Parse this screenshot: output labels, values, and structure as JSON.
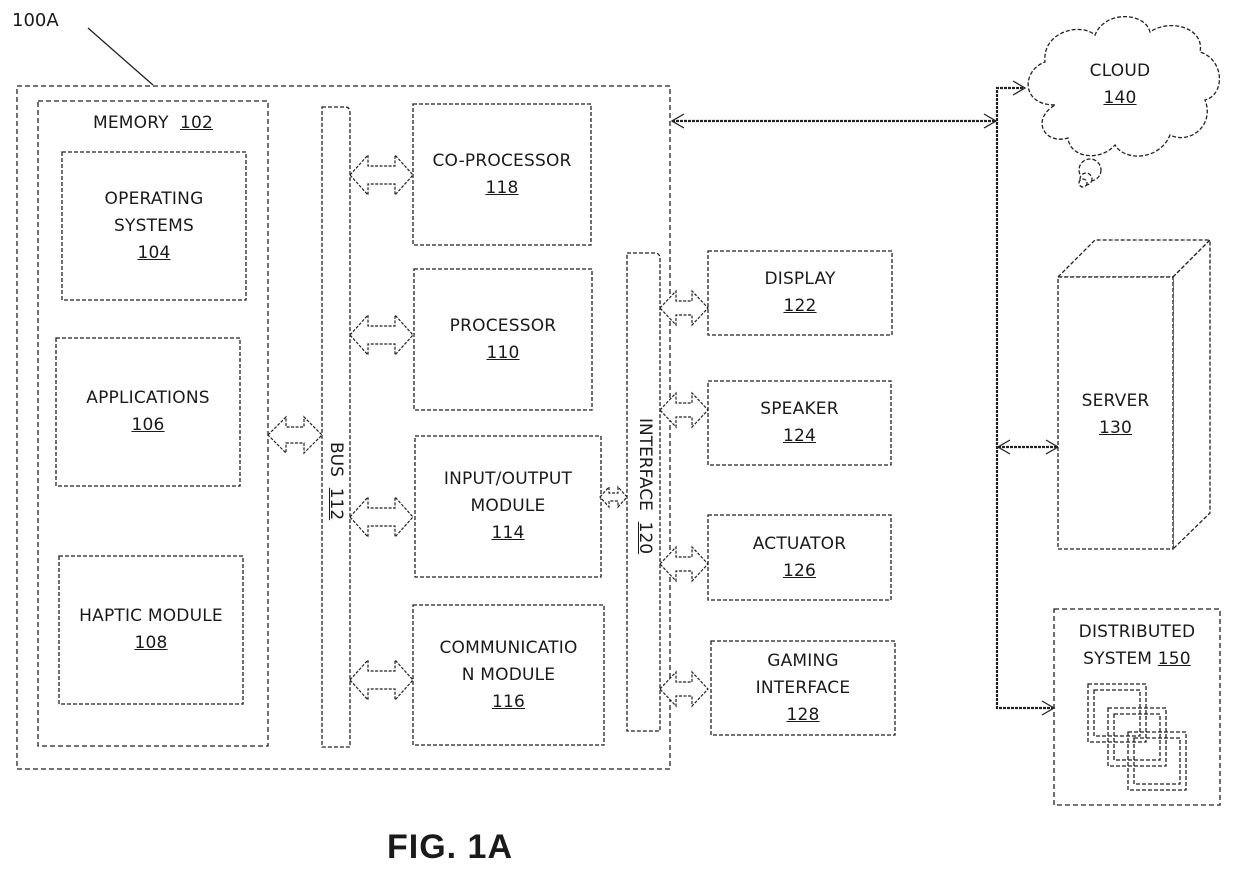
{
  "figure_label": "FIG. 1A",
  "system_ref": "100A",
  "memory": {
    "name": "MEMORY",
    "ref": "102"
  },
  "memory_items": [
    {
      "line1": "OPERATING",
      "line2": "SYSTEMS",
      "ref": "104"
    },
    {
      "line1": "APPLICATIONS",
      "line2": "",
      "ref": "106"
    },
    {
      "line1": "HAPTIC MODULE",
      "line2": "",
      "ref": "108"
    }
  ],
  "bus": {
    "name": "BUS",
    "ref": "112"
  },
  "interface": {
    "name": "INTERFACE",
    "ref": "120"
  },
  "bus_modules": [
    {
      "line1": "CO-PROCESSOR",
      "line2": "",
      "ref": "118"
    },
    {
      "line1": "PROCESSOR",
      "line2": "",
      "ref": "110"
    },
    {
      "line1": "INPUT/OUTPUT",
      "line2": "MODULE",
      "ref": "114"
    },
    {
      "line1": "COMMUNICATIO",
      "line2": "N MODULE",
      "ref": "116"
    }
  ],
  "peripherals": [
    {
      "line1": "DISPLAY",
      "line2": "",
      "ref": "122"
    },
    {
      "line1": "SPEAKER",
      "line2": "",
      "ref": "124"
    },
    {
      "line1": "ACTUATOR",
      "line2": "",
      "ref": "126"
    },
    {
      "line1": "GAMING",
      "line2": "INTERFACE",
      "ref": "128"
    }
  ],
  "cloud": {
    "name": "CLOUD",
    "ref": "140"
  },
  "server": {
    "name": "SERVER",
    "ref": "130"
  },
  "distributed": {
    "line1": "DISTRIBUTED",
    "line2": "SYSTEM",
    "ref": "150"
  }
}
